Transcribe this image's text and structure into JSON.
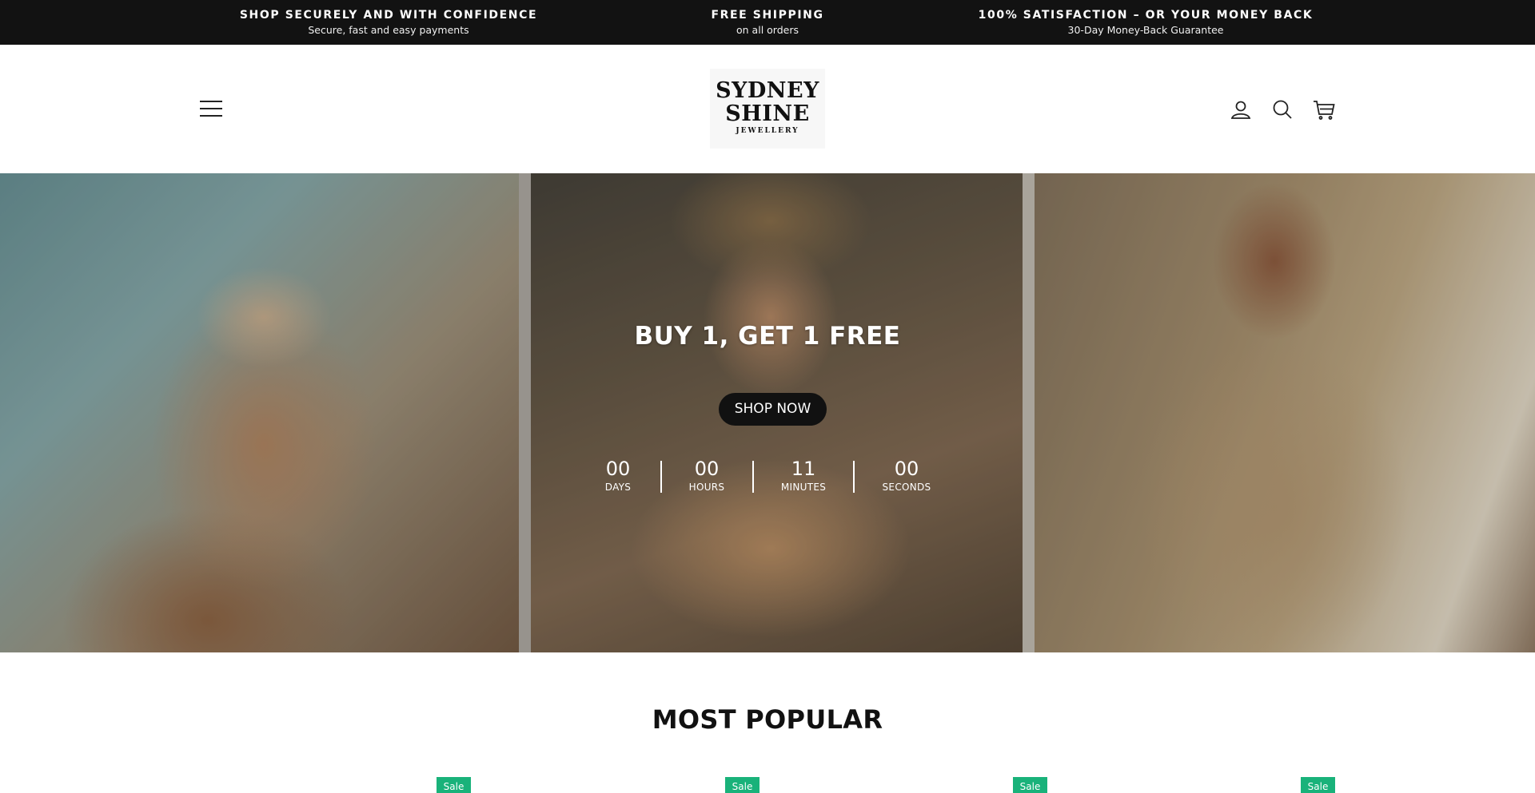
{
  "announcement": {
    "items": [
      {
        "title": "SHOP SECURELY AND WITH CONFIDENCE",
        "subtitle": "Secure, fast and easy payments"
      },
      {
        "title": "FREE SHIPPING",
        "subtitle": "on all orders"
      },
      {
        "title": "100% SATISFACTION – OR YOUR MONEY BACK",
        "subtitle": "30-Day Money-Back Guarantee"
      }
    ]
  },
  "header": {
    "logo": {
      "line1": "SYDNEY",
      "line2": "SHINE",
      "line3": "JEWELLERY"
    },
    "icons": [
      "menu-icon",
      "account-icon",
      "search-icon",
      "cart-icon"
    ]
  },
  "hero": {
    "title": "BUY 1, GET 1 FREE",
    "button_label": "SHOP NOW",
    "countdown": [
      {
        "value": "00",
        "label": "DAYS"
      },
      {
        "value": "00",
        "label": "HOURS"
      },
      {
        "value": "11",
        "label": "MINUTES"
      },
      {
        "value": "00",
        "label": "SECONDS"
      }
    ]
  },
  "most_popular": {
    "title": "MOST POPULAR",
    "badges": [
      "Sale",
      "Sale",
      "Sale",
      "Sale"
    ]
  },
  "colors": {
    "announcement_bg": "#121212",
    "sale_badge": "#19b27a",
    "button_bg": "#111111"
  }
}
